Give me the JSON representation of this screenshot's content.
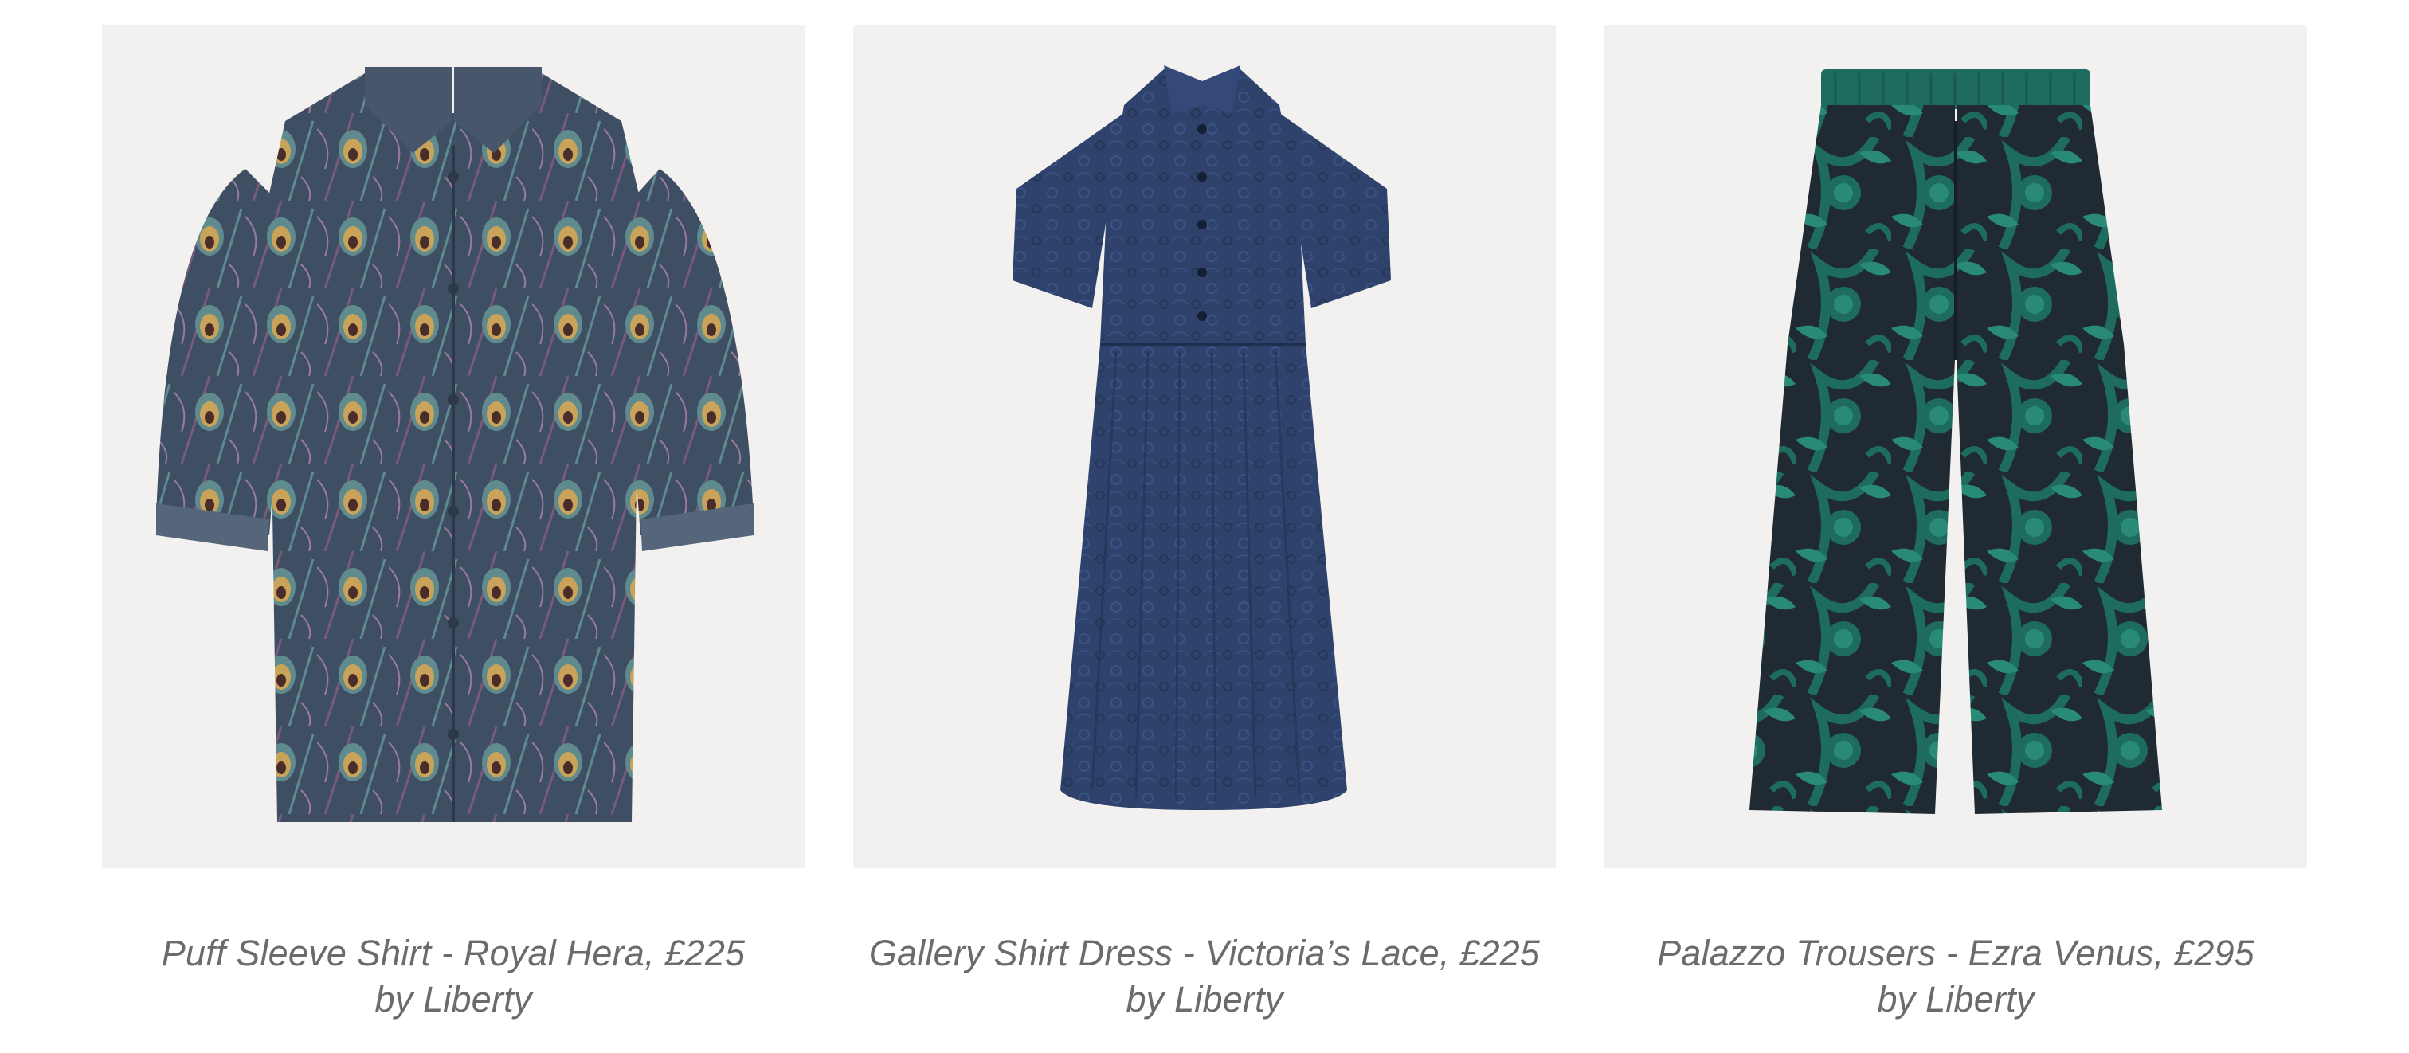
{
  "products": [
    {
      "title": "Puff Sleeve Shirt - Royal Hera, £225",
      "brand": "by Liberty",
      "image_alt": "Puff sleeve shirt in peacock feather print",
      "colors": {
        "base": "#3e4e63",
        "accent1": "#7a5a7c",
        "accent2": "#c9a35a",
        "accent3": "#5f8a8e"
      }
    },
    {
      "title": "Gallery Shirt Dress - Victoria’s Lace, £225",
      "brand": "by Liberty",
      "image_alt": "Navy short sleeve shirt dress with lace print",
      "colors": {
        "base": "#2e426b",
        "accent1": "#253656",
        "accent2": "#1a2740"
      }
    },
    {
      "title": "Palazzo Trousers - Ezra Venus, £295",
      "brand": "by Liberty",
      "image_alt": "Wide leg trousers in green floral print",
      "colors": {
        "base": "#1e6b5f",
        "accent1": "#1f2a33",
        "accent2": "#2a8a78"
      }
    }
  ]
}
